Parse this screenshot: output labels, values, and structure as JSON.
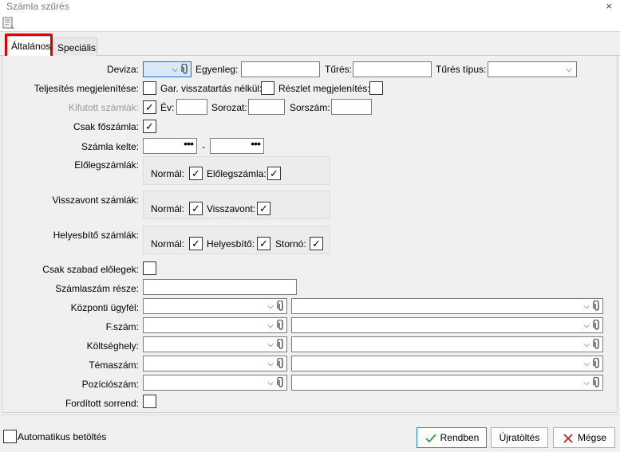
{
  "window": {
    "title": "Számla szűrés",
    "close": "×"
  },
  "tabs": [
    {
      "label": "Általános",
      "active": true
    },
    {
      "label": "Speciális",
      "active": false
    }
  ],
  "colors": {
    "highlight": "#e00000",
    "focus": "#0078d7",
    "ok_check": "#2e9a3e",
    "cancel_x": "#d02020"
  },
  "form": {
    "deviza": {
      "label": "Deviza:",
      "value": ""
    },
    "egyenleg": {
      "label": "Egyenleg:",
      "value": ""
    },
    "turés": {
      "label": "Tűrés:",
      "value": ""
    },
    "tures_tipus": {
      "label": "Tűrés típus:",
      "value": ""
    },
    "teljesites": {
      "label": "Teljesítés megjelenítése:",
      "checked": false
    },
    "gar": {
      "label": "Gar. visszatartás nélkül:",
      "checked": false
    },
    "reszlet": {
      "label": "Részlet megjelenítés:",
      "checked": false
    },
    "kifutott": {
      "label": "Kifutott számlák:",
      "checked": true
    },
    "ev": {
      "label": "Év:",
      "value": ""
    },
    "sorozat": {
      "label": "Sorozat:",
      "value": ""
    },
    "sorszam": {
      "label": "Sorszám:",
      "value": ""
    },
    "csak_foszamla": {
      "label": "Csak főszámla:",
      "checked": true
    },
    "szamla_kelte": {
      "label": "Számla kelte:",
      "from": "",
      "to": "",
      "separator": "-"
    },
    "elolegszamlak": {
      "label": "Előlegszámlák:",
      "normal_label": "Normál:",
      "normal": true,
      "second_label": "Előlegszámla:",
      "second": true
    },
    "visszavont": {
      "label": "Visszavont számlák:",
      "normal_label": "Normál:",
      "normal": true,
      "second_label": "Visszavont:",
      "second": true
    },
    "helyesbito": {
      "label": "Helyesbítő számlák:",
      "normal_label": "Normál:",
      "normal": true,
      "second_label": "Helyesbítő:",
      "second": true,
      "third_label": "Stornó:",
      "third": true
    },
    "csak_szabad": {
      "label": "Csak szabad előlegek:",
      "checked": false
    },
    "szamlaszam_resze": {
      "label": "Számlaszám része:",
      "value": ""
    },
    "kozponti_ugyfel": {
      "label": "Központi ügyfél:",
      "value": ""
    },
    "fszam": {
      "label": "F.szám:",
      "value": ""
    },
    "koltseghely": {
      "label": "Költséghely:",
      "value": ""
    },
    "temaszam": {
      "label": "Témaszám:",
      "value": ""
    },
    "pozicioszam": {
      "label": "Pozíciószám:",
      "value": ""
    },
    "forditott": {
      "label": "Fordított sorrend:",
      "checked": false
    }
  },
  "footer": {
    "auto_load": {
      "label": "Automatikus betöltés",
      "checked": false
    },
    "ok": "Rendben",
    "reload": "Újratöltés",
    "cancel": "Mégse"
  },
  "glyphs": {
    "check": "✓",
    "arrow": "⌵",
    "dots": "•••"
  }
}
